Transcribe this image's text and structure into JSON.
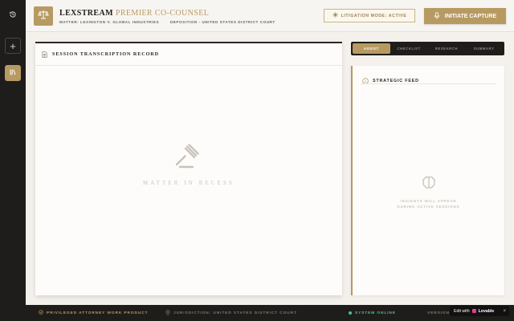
{
  "app": {
    "brand_main": "LEXSTREAM",
    "brand_accent": "PREMIER CO-COUNSEL",
    "matter": "MATTER: LEXINGTON V. GLOBAL INDUSTRIES",
    "deposition": "DEPOSITION - UNITED STATES DISTRICT COURT"
  },
  "header": {
    "mode_label": "LITIGATION MODE: ACTIVE",
    "capture_label": "INITIATE CAPTURE"
  },
  "transcript": {
    "title": "SESSION TRANSCRIPTION RECORD",
    "empty_state": "MATTER IN RECESS"
  },
  "tabs": [
    {
      "label": "ASSIST",
      "active": true
    },
    {
      "label": "CHECKLIST",
      "active": false
    },
    {
      "label": "RESEARCH",
      "active": false
    },
    {
      "label": "SUMMARY",
      "active": false
    }
  ],
  "feed": {
    "title": "STRATEGIC FEED",
    "empty_line1": "INSIGHTS WILL APPEAR",
    "empty_line2": "DURING ACTIVE SESSIONS"
  },
  "footer": {
    "privileged": "PRIVILEGED ATTORNEY WORK PRODUCT",
    "jurisdiction": "JURISDICTION: UNITED STATES DISTRICT COURT",
    "system": "SYSTEM ONLINE",
    "version": "VERSION"
  },
  "badge": {
    "edit_with": "Edit with",
    "brand": "Lovable",
    "close": "×"
  },
  "icons": {
    "rail_history": "history-icon",
    "rail_add": "plus-icon",
    "rail_library": "library-icon",
    "logo": "scales-icon",
    "mode": "sparkle-icon",
    "capture": "microphone-icon",
    "transcript": "document-icon",
    "recess": "gavel-icon",
    "feed": "info-icon",
    "feed_empty": "brain-icon",
    "privileged": "shield-icon",
    "jurisdiction": "location-pin-icon",
    "system": "status-dot-icon"
  },
  "colors": {
    "accent_gold": "#b79a62",
    "dark": "#1f1d1b",
    "status_green": "#4fc08d"
  }
}
